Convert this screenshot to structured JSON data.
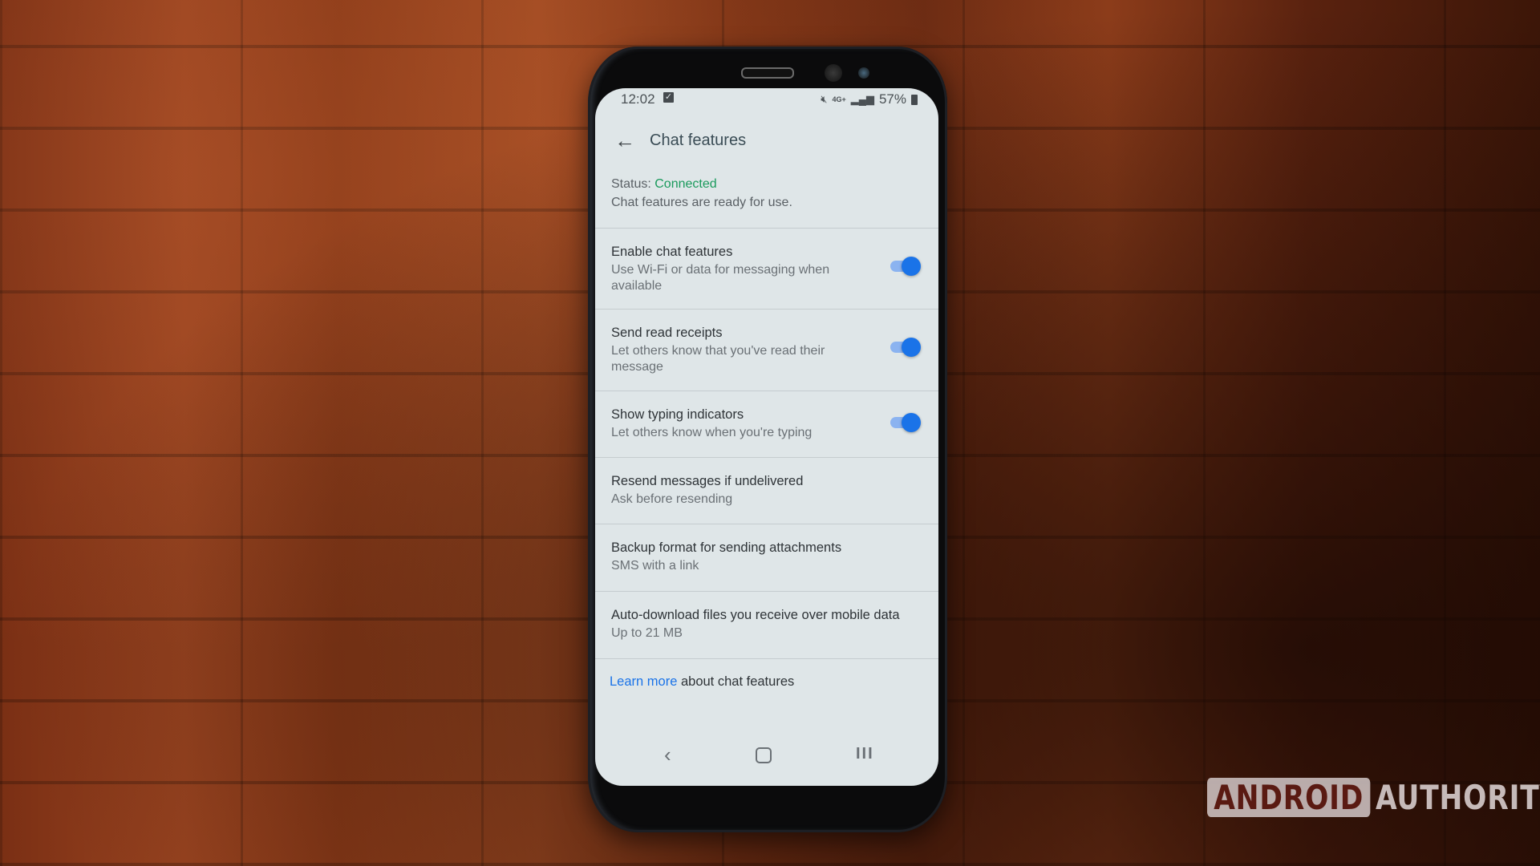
{
  "status_bar": {
    "time": "12:02",
    "notification_icon": "checkbox-icon",
    "icons": [
      "mute-icon",
      "4g-plus-icon",
      "signal-icon"
    ],
    "network": "4G+",
    "battery": "57%"
  },
  "app_bar": {
    "back_icon": "←",
    "title": "Chat features"
  },
  "status": {
    "label": "Status: ",
    "value": "Connected",
    "value_color": "#1a9a5c",
    "description": "Chat features are ready for use."
  },
  "settings": [
    {
      "title": "Enable chat features",
      "subtitle": "Use Wi-Fi or data for messaging when available",
      "toggle": true
    },
    {
      "title": "Send read receipts",
      "subtitle": "Let others know that you've read their message",
      "toggle": true
    },
    {
      "title": "Show typing indicators",
      "subtitle": "Let others know when you're typing",
      "toggle": true
    },
    {
      "title": "Resend messages if undelivered",
      "subtitle": "Ask before resending"
    },
    {
      "title": "Backup format for sending attachments",
      "subtitle": "SMS with a link"
    },
    {
      "title": "Auto-download files you receive over mobile data",
      "subtitle": "Up to 21 MB"
    }
  ],
  "footer": {
    "link_text": "Learn more",
    "rest_text": " about chat features",
    "link_color": "#1a73e8"
  },
  "nav_bar": {
    "back": "‹",
    "recent": "III"
  },
  "watermark": {
    "boxed": "ANDROID",
    "plain": "AUTHORITY"
  },
  "colors": {
    "accent": "#1a73e8",
    "screen_bg": "#dfe6e8"
  }
}
